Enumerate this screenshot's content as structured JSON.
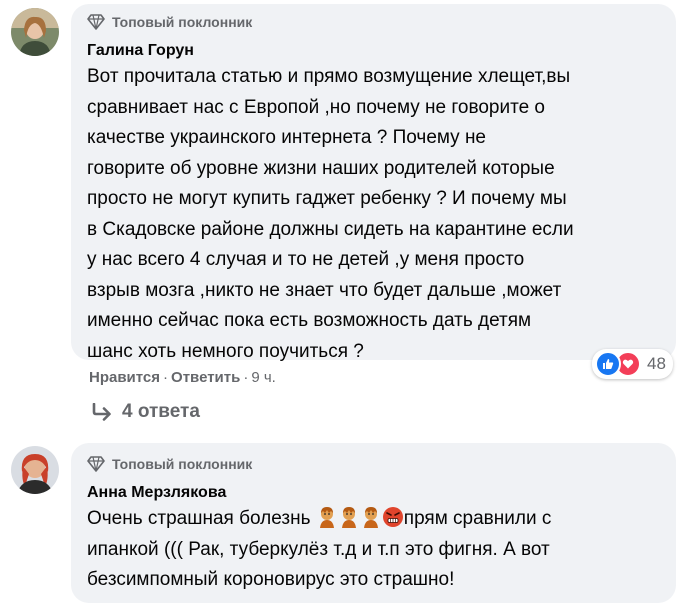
{
  "comments": [
    {
      "badge": "Топовый поклонник",
      "author": "Галина Горун",
      "text": "Вот прочитала статью и прямо возмущение хлещет,вы\nсравнивает нас с Европой ,но почему не говорите о\nкачестве украинского интернета ? Почему не\nговорите об уровне жизни наших родителей которые\nпросто не могут купить гаджет ребенку ? И почему мы\nв Скадовске районе должны сидеть на карантине если\nу нас всего 4 случая и то не детей ,у меня просто\nвзрыв мозга ,никто не знает что будет дальше ,может\nименно сейчас пока есть возможность дать детям\nшанс хоть немного поучиться ?",
      "like": "Нравится",
      "dot1": "·",
      "reply": "Ответить",
      "dot2": "·",
      "time": "9 ч.",
      "reaction_count": "48",
      "replies": "4 ответа"
    },
    {
      "badge": "Топовый поклонник",
      "author": "Анна Мерзлякова",
      "text_line1_a": "Очень страшная болезнь ",
      "text_line1_b": "прям сравнили с",
      "text_rest": "ипанкой ((( Рак, туберкулёз т.д и т.п это фигня. А вот\nбезсимпомный короновирус это страшно!"
    }
  ],
  "colors": {
    "bubble": "#f0f2f5",
    "meta": "#65676b",
    "like_blue": "#1877f2",
    "love_red": "#f33e58"
  },
  "icons": [
    "diamond-icon",
    "reply-arrow-icon",
    "like-reaction-icon",
    "love-reaction-icon",
    "zombie-emoji-icon",
    "angry-emoji-icon"
  ]
}
